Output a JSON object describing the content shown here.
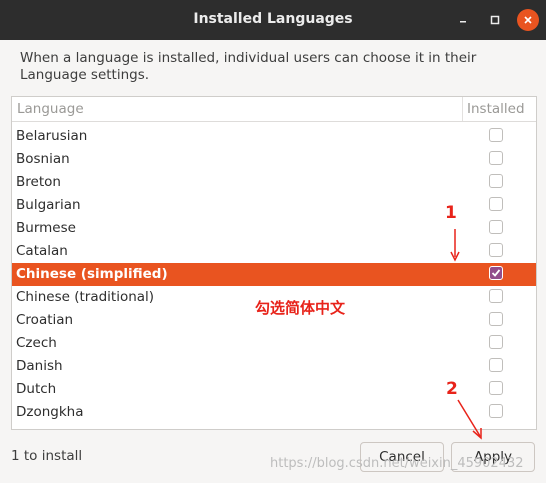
{
  "window": {
    "title": "Installed Languages",
    "accent_color": "#e95420"
  },
  "description": "When a language is installed, individual users can choose it in their Language settings.",
  "table": {
    "headers": {
      "language": "Language",
      "installed": "Installed"
    },
    "rows": [
      {
        "label": "Belarusian",
        "checked": false
      },
      {
        "label": "Bosnian",
        "checked": false
      },
      {
        "label": "Breton",
        "checked": false
      },
      {
        "label": "Bulgarian",
        "checked": false
      },
      {
        "label": "Burmese",
        "checked": false
      },
      {
        "label": "Catalan",
        "checked": false
      },
      {
        "label": "Chinese (simplified)",
        "checked": true,
        "selected": true
      },
      {
        "label": "Chinese (traditional)",
        "checked": false
      },
      {
        "label": "Croatian",
        "checked": false
      },
      {
        "label": "Czech",
        "checked": false
      },
      {
        "label": "Danish",
        "checked": false
      },
      {
        "label": "Dutch",
        "checked": false
      },
      {
        "label": "Dzongkha",
        "checked": false
      }
    ]
  },
  "annotations": {
    "step1": "1",
    "step2": "2",
    "note": "勾选简体中文",
    "color": "#e8231a"
  },
  "footer": {
    "status": "1 to install",
    "cancel_label": "Cancel",
    "apply_label": "Apply"
  },
  "watermark": "https://blog.csdn.net/weixin_45902432"
}
